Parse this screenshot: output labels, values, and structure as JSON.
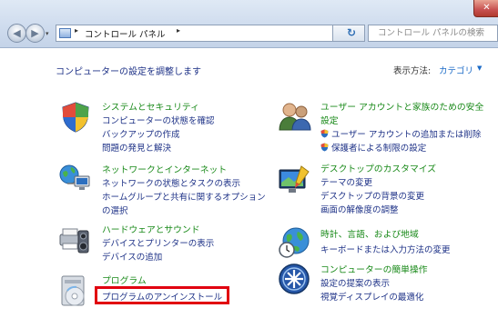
{
  "window": {
    "close_glyph": "✕"
  },
  "nav": {
    "back_glyph": "◀",
    "forward_glyph": "▶",
    "dropdown_glyph": "▾"
  },
  "address": {
    "icon": "control-panel-icon",
    "sep_glyph": "▸",
    "path": "コントロール パネル",
    "dropdown_glyph": "▾",
    "refresh_glyph": "↻"
  },
  "search": {
    "placeholder": "コントロール パネルの検索"
  },
  "heading": "コンピューターの設定を調整します",
  "view_by": {
    "label": "表示方法:",
    "value": "カテゴリ",
    "caret": "▼"
  },
  "categories": {
    "system": {
      "icon": "system-security-icon",
      "title": "システムとセキュリティ",
      "links": [
        "コンピューターの状態を確認",
        "バックアップの作成",
        "問題の発見と解決"
      ]
    },
    "network": {
      "icon": "network-internet-icon",
      "title": "ネットワークとインターネット",
      "links": [
        "ネットワークの状態とタスクの表示",
        "ホームグループと共有に関するオプション",
        "の選択"
      ]
    },
    "hardware": {
      "icon": "hardware-sound-icon",
      "title": "ハードウェアとサウンド",
      "links": [
        "デバイスとプリンターの表示",
        "デバイスの追加"
      ]
    },
    "programs": {
      "icon": "programs-icon",
      "title": "プログラム",
      "links": [
        "プログラムのアンインストール"
      ]
    },
    "users": {
      "icon": "user-accounts-icon",
      "title": [
        "ユーザー アカウントと家族のための安全",
        "設定"
      ],
      "links": [
        "ユーザー アカウントの追加または削除",
        "保護者による制限の設定"
      ]
    },
    "appearance": {
      "icon": "appearance-personalization-icon",
      "title": "デスクトップのカスタマイズ",
      "links": [
        "テーマの変更",
        "デスクトップの背景の変更",
        "画面の解像度の調整"
      ]
    },
    "clock": {
      "icon": "clock-language-region-icon",
      "title": "時計、言語、および地域",
      "links": [
        "キーボードまたは入力方法の変更"
      ]
    },
    "ease": {
      "icon": "ease-of-access-icon",
      "title": "コンピューターの簡単操作",
      "links": [
        "設定の提案の表示",
        "視覚ディスプレイの最適化"
      ]
    }
  },
  "colors": {
    "category_title": "#1a8a1a",
    "link": "#1e3287",
    "highlight_box": "#e1000f"
  }
}
